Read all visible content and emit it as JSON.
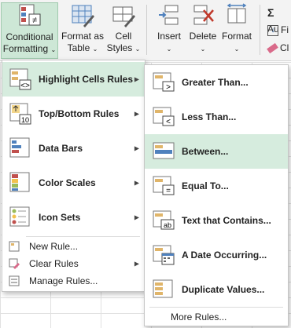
{
  "ribbon": {
    "conditional_line1": "Conditional",
    "conditional_line2": "Formatting",
    "table_line1": "Format as",
    "table_line2": "Table",
    "styles_line1": "Cell",
    "styles_line2": "Styles",
    "insert": "Insert",
    "delete": "Delete",
    "format": "Format",
    "autosum": "Au",
    "fill": "Fi",
    "clear": "Cl"
  },
  "menu": {
    "items": [
      {
        "label": "Highlight Cells Rules",
        "icon": "highlight-cells-icon",
        "has_submenu": true,
        "highlighted": true
      },
      {
        "label": "Top/Bottom Rules",
        "icon": "top-bottom-icon",
        "has_submenu": true
      },
      {
        "label": "Data Bars",
        "icon": "data-bars-icon",
        "has_submenu": true
      },
      {
        "label": "Color Scales",
        "icon": "color-scales-icon",
        "has_submenu": true
      },
      {
        "label": "Icon Sets",
        "icon": "icon-sets-icon",
        "has_submenu": true
      },
      {
        "label": "New Rule...",
        "icon": "new-rule-icon"
      },
      {
        "label": "Clear Rules",
        "icon": "clear-rules-icon",
        "has_submenu": true
      },
      {
        "label": "Manage Rules...",
        "icon": "manage-rules-icon"
      }
    ]
  },
  "submenu": {
    "items": [
      {
        "label": "Greater Than...",
        "icon": "greater-than-icon"
      },
      {
        "label": "Less Than...",
        "icon": "less-than-icon"
      },
      {
        "label": "Between...",
        "icon": "between-icon",
        "highlighted": true
      },
      {
        "label": "Equal To...",
        "icon": "equal-to-icon"
      },
      {
        "label": "Text that Contains...",
        "icon": "text-contains-icon"
      },
      {
        "label": "A Date Occurring...",
        "icon": "calendar-icon"
      },
      {
        "label": "Duplicate Values...",
        "icon": "duplicate-values-icon"
      }
    ],
    "more_rules": "More Rules..."
  },
  "colors": {
    "highlight": "#d6ecde",
    "active_button": "#cde7d6",
    "ribbon_bg": "#f3f3f3"
  }
}
